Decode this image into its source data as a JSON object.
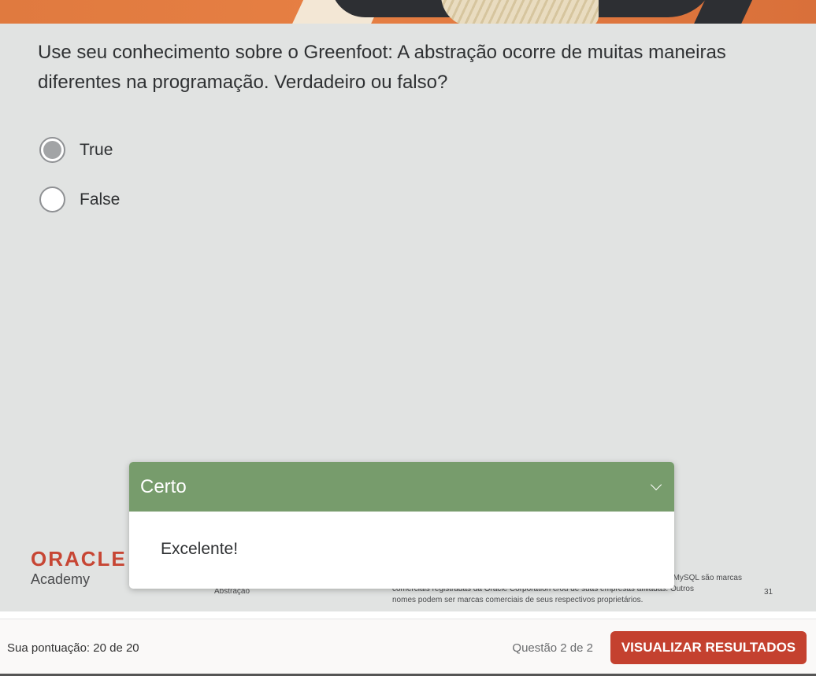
{
  "quiz": {
    "question": " Use seu conhecimento sobre o Greenfoot: A abstração ocorre de muitas maneiras diferentes na programação. Verdadeiro ou falso?",
    "options": [
      {
        "label": "True",
        "selected": true
      },
      {
        "label": "False",
        "selected": false
      }
    ]
  },
  "feedback": {
    "title": "Certo",
    "message": "Excelente!",
    "header_color": "#779c6c"
  },
  "slide_footer": {
    "brand": "ORACLE",
    "sub_brand": "Academy",
    "section": "Abstração",
    "legal_line1": "MySQL são marcas",
    "legal_line2": "comerciais registradas da Oracle Corporation e/ou de suas empresas afiliadas. Outros",
    "legal_line3": "nomes podem ser marcas comerciais de seus respectivos proprietários.",
    "page_number": "31"
  },
  "bottom_bar": {
    "score": "Sua pontuação: 20 de 20",
    "counter": "Questão 2 de 2",
    "results_button": "VISUALIZAR RESULTADOS",
    "button_color": "#c4412f"
  }
}
